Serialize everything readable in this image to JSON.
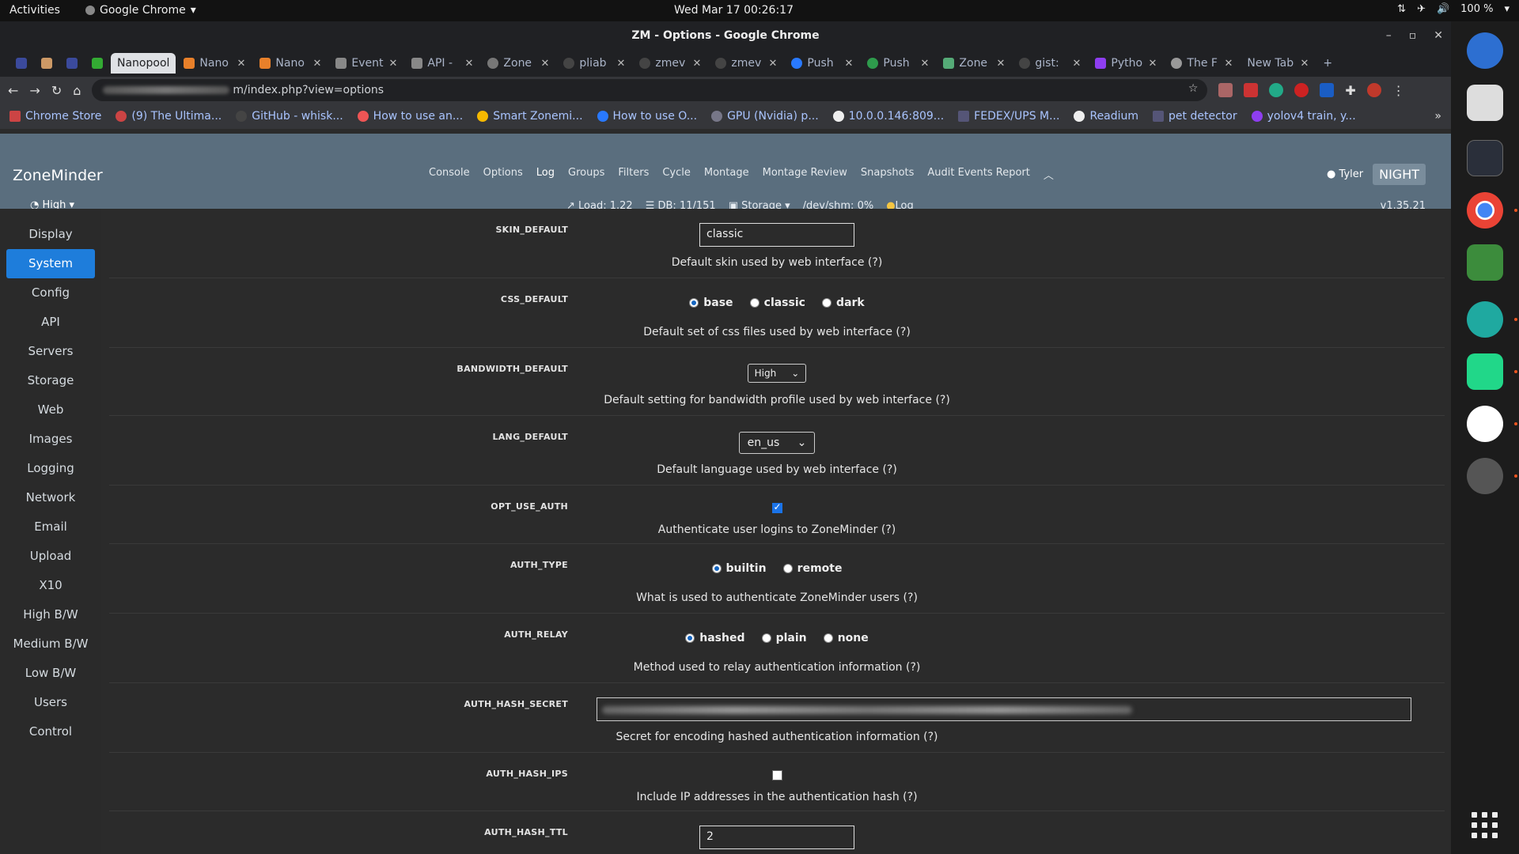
{
  "system": {
    "activities": "Activities",
    "app_name": "Google Chrome",
    "clock": "Wed Mar 17  00:26:17",
    "battery": "100 %"
  },
  "window": {
    "title": "ZM - Options - Google Chrome"
  },
  "tabs": [
    {
      "label": ""
    },
    {
      "label": ""
    },
    {
      "label": ""
    },
    {
      "label": ""
    },
    {
      "label": "Nanopool",
      "active": true
    },
    {
      "label": "Nano"
    },
    {
      "label": "Nano"
    },
    {
      "label": "Event"
    },
    {
      "label": "API -"
    },
    {
      "label": "Zone"
    },
    {
      "label": "pliab"
    },
    {
      "label": "zmev"
    },
    {
      "label": "zmev"
    },
    {
      "label": "Push"
    },
    {
      "label": "Push"
    },
    {
      "label": "Zone"
    },
    {
      "label": "gist:"
    },
    {
      "label": "Pytho"
    },
    {
      "label": "The F"
    },
    {
      "label": "New Tab"
    }
  ],
  "address_bar": {
    "url_suffix": "m/index.php?view=options"
  },
  "bookmarks": [
    "Chrome Store",
    "(9) The Ultima...",
    "GitHub - whisk...",
    "How to use an...",
    "Smart Zonemi...",
    "How to use O...",
    "GPU (Nvidia) p...",
    "10.0.0.146:809...",
    "FEDEX/UPS M...",
    "Readium",
    "pet detector",
    "yolov4 train, y..."
  ],
  "zm": {
    "brand": "ZoneMinder",
    "bandwidth": "High",
    "nav": [
      "Console",
      "Options",
      "Log",
      "Groups",
      "Filters",
      "Cycle",
      "Montage",
      "Montage Review",
      "Snapshots",
      "Audit Events Report"
    ],
    "user": "Tyler",
    "night": "NIGHT",
    "status": {
      "load": "Load: 1.22",
      "db": "DB: 11/151",
      "storage": "Storage",
      "shm": "/dev/shm: 0%",
      "log": "Log"
    },
    "version": "v1.35.21"
  },
  "sidebar": [
    "Display",
    "System",
    "Config",
    "API",
    "Servers",
    "Storage",
    "Web",
    "Images",
    "Logging",
    "Network",
    "Email",
    "Upload",
    "X10",
    "High B/W",
    "Medium B/W",
    "Low B/W",
    "Users",
    "Control"
  ],
  "sidebar_active": "System",
  "options": {
    "skin_default": {
      "label": "SKIN_DEFAULT",
      "value": "classic",
      "desc": "Default skin used by web interface (?)"
    },
    "css_default": {
      "label": "CSS_DEFAULT",
      "choices": [
        "base",
        "classic",
        "dark"
      ],
      "selected": "base",
      "desc": "Default set of css files used by web interface (?)"
    },
    "bandwidth_default": {
      "label": "BANDWIDTH_DEFAULT",
      "value": "High",
      "desc": "Default setting for bandwidth profile used by web interface (?)"
    },
    "lang_default": {
      "label": "LANG_DEFAULT",
      "value": "en_us",
      "desc": "Default language used by web interface (?)"
    },
    "opt_use_auth": {
      "label": "OPT_USE_AUTH",
      "checked": true,
      "desc": "Authenticate user logins to ZoneMinder (?)"
    },
    "auth_type": {
      "label": "AUTH_TYPE",
      "choices": [
        "builtin",
        "remote"
      ],
      "selected": "builtin",
      "desc": "What is used to authenticate ZoneMinder users (?)"
    },
    "auth_relay": {
      "label": "AUTH_RELAY",
      "choices": [
        "hashed",
        "plain",
        "none"
      ],
      "selected": "hashed",
      "desc": "Method used to relay authentication information (?)"
    },
    "auth_hash_secret": {
      "label": "AUTH_HASH_SECRET",
      "desc": "Secret for encoding hashed authentication information (?)"
    },
    "auth_hash_ips": {
      "label": "AUTH_HASH_IPS",
      "checked": false,
      "desc": "Include IP addresses in the authentication hash (?)"
    },
    "auth_hash_ttl": {
      "label": "AUTH_HASH_TTL",
      "value": "2"
    }
  },
  "colors": {
    "zm_header": "#5a6e7e",
    "active_blue": "#1e7ddb",
    "content_bg": "#2b2b2b"
  }
}
